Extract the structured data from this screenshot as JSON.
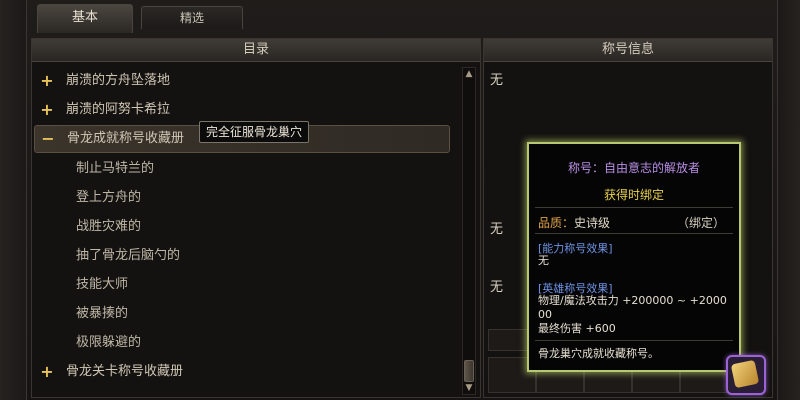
{
  "tabs": [
    {
      "label": "基本",
      "active": true
    },
    {
      "label": "精选",
      "active": false
    }
  ],
  "catalog": {
    "header": "目录",
    "items": [
      {
        "sign": "+",
        "label": "崩溃的方舟坠落地",
        "type": "group"
      },
      {
        "sign": "+",
        "label": "崩溃的阿努卡希拉",
        "type": "group"
      },
      {
        "sign": "−",
        "label": "骨龙成就称号收藏册",
        "type": "group",
        "selected": true
      },
      {
        "sign": "",
        "label": "制止马特兰的",
        "type": "child"
      },
      {
        "sign": "",
        "label": "登上方舟的",
        "type": "child"
      },
      {
        "sign": "",
        "label": "战胜灾难的",
        "type": "child"
      },
      {
        "sign": "",
        "label": "抽了骨龙后脑勺的",
        "type": "child"
      },
      {
        "sign": "",
        "label": "技能大师",
        "type": "child"
      },
      {
        "sign": "",
        "label": "被暴揍的",
        "type": "child"
      },
      {
        "sign": "",
        "label": "极限躲避的",
        "type": "child"
      },
      {
        "sign": "+",
        "label": "骨龙关卡称号收藏册",
        "type": "group"
      }
    ],
    "hover_tooltip": "完全征服骨龙巢穴"
  },
  "info": {
    "header": "称号信息",
    "values": [
      "无",
      "无",
      "无"
    ]
  },
  "tooltip": {
    "title": "称号：自由意志的解放者",
    "binding": "获得时绑定",
    "quality_label": "品质：",
    "quality_value": "史诗级",
    "lock": "（绑定）",
    "section1_title": "[能力称号效果]",
    "section1_text": "无",
    "section2_title": "[英雄称号效果]",
    "section2_line1": "物理/魔法攻击力 +200000 ~ +2000",
    "section2_line2": "00",
    "section2_line3": "最终伤害 +600",
    "description": "骨龙巢穴成就收藏称号。"
  },
  "colors": {
    "title_purple": "#b98ee6",
    "binding_yellow": "#e8d14f",
    "quality_orange": "#e0a24a",
    "section_blue": "#6f93e6",
    "tooltip_border": "#b8c870",
    "expand_gold": "#e8c25a"
  },
  "icons": {
    "expand": "plus-icon",
    "collapse": "minus-icon",
    "scroll_up": "triangle-up",
    "scroll_down": "triangle-down"
  }
}
